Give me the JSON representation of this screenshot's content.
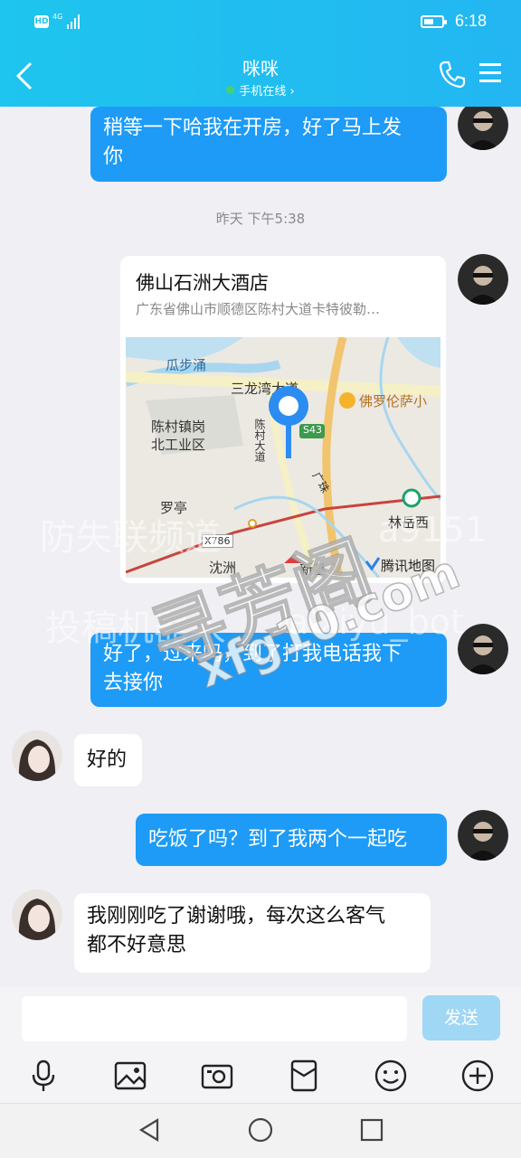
{
  "status_bar": {
    "hd": "HD",
    "network": "4G",
    "time": "6:18",
    "battery_level": 0.55
  },
  "header": {
    "title": "咪咪",
    "status": "手机在线 ›"
  },
  "messages": [
    {
      "side": "out",
      "text_line1": "稍等一下哈我在开房，好了马上发",
      "text_line2": "你"
    },
    {
      "timestamp": "昨天 下午5:38"
    },
    {
      "side": "out",
      "type": "location",
      "title": "佛山石洲大酒店",
      "address": "广东省佛山市顺德区陈村大道卡特彼勒…",
      "map_labels": [
        "瓜步涌",
        "三龙湾大道",
        "佛罗伦萨小",
        "陈村镇岗",
        "北工业区",
        "陈村大道",
        "S43",
        "罗亭",
        "林岳西",
        "X786",
        "广珠",
        "沈洲",
        "新基",
        "腾讯地图"
      ]
    },
    {
      "side": "out",
      "text_line1": "好了，过来吗，到了打我电话我下",
      "text_line2": "去接你"
    },
    {
      "side": "in",
      "text_line1": "好的"
    },
    {
      "side": "out",
      "text_line1": "吃饭了吗？到了我两个一起吃"
    },
    {
      "side": "in",
      "text_line1": "我刚刚吃了谢谢哦，每次这么客气",
      "text_line2": "都不好意思"
    }
  ],
  "input": {
    "value": "",
    "send_label": "发送"
  },
  "toolbar": {
    "icons": [
      "microphone-icon",
      "image-icon",
      "camera-icon",
      "red-packet-icon",
      "emoji-icon",
      "plus-icon"
    ]
  },
  "watermark": {
    "line1": "防失联频道",
    "line1b": "a9151",
    "line2": "投稿机器人",
    "line2b": "aixiyu_bot",
    "big": "寻芳阁",
    "url": "xfg10.com"
  },
  "colors": {
    "accent": "#1ec5ee",
    "bubble_out": "#1d9bf6",
    "online_dot": "#43d26d"
  }
}
